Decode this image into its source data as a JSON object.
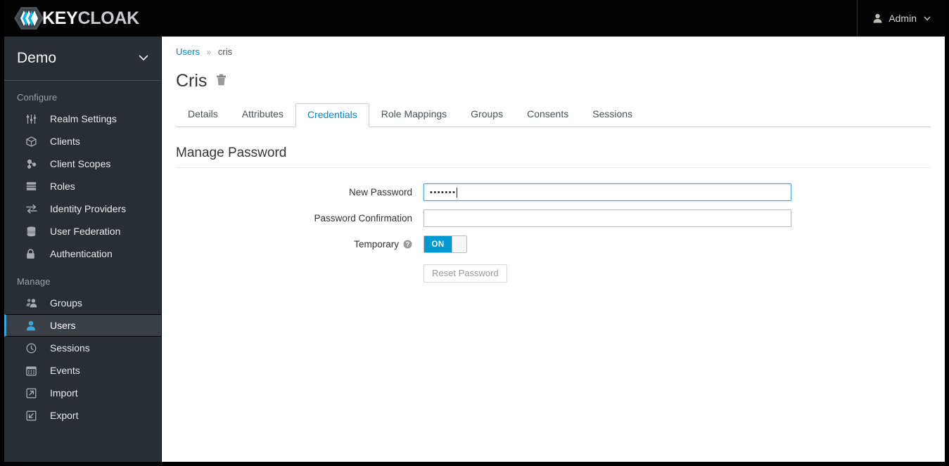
{
  "navbar": {
    "brand_part1": "KEY",
    "brand_part2": "CLOAK",
    "user_label": "Admin"
  },
  "sidebar": {
    "realm": "Demo",
    "groups": [
      {
        "label": "Configure",
        "items": [
          {
            "label": "Realm Settings",
            "icon": "sliders-icon",
            "active": false
          },
          {
            "label": "Clients",
            "icon": "cube-icon",
            "active": false
          },
          {
            "label": "Client Scopes",
            "icon": "molecule-icon",
            "active": false
          },
          {
            "label": "Roles",
            "icon": "server-stack-icon",
            "active": false
          },
          {
            "label": "Identity Providers",
            "icon": "exchange-arrows-icon",
            "active": false
          },
          {
            "label": "User Federation",
            "icon": "database-icon",
            "active": false
          },
          {
            "label": "Authentication",
            "icon": "lock-icon",
            "active": false
          }
        ]
      },
      {
        "label": "Manage",
        "items": [
          {
            "label": "Groups",
            "icon": "users-group-icon",
            "active": false
          },
          {
            "label": "Users",
            "icon": "user-icon",
            "active": true
          },
          {
            "label": "Sessions",
            "icon": "clock-icon",
            "active": false
          },
          {
            "label": "Events",
            "icon": "calendar-icon",
            "active": false
          },
          {
            "label": "Import",
            "icon": "import-arrow-icon",
            "active": false
          },
          {
            "label": "Export",
            "icon": "export-arrow-icon",
            "active": false
          }
        ]
      }
    ]
  },
  "breadcrumb": {
    "parent": "Users",
    "separator": "»",
    "current": "cris"
  },
  "page": {
    "title": "Cris"
  },
  "tabs": [
    {
      "label": "Details",
      "active": false
    },
    {
      "label": "Attributes",
      "active": false
    },
    {
      "label": "Credentials",
      "active": true
    },
    {
      "label": "Role Mappings",
      "active": false
    },
    {
      "label": "Groups",
      "active": false
    },
    {
      "label": "Consents",
      "active": false
    },
    {
      "label": "Sessions",
      "active": false
    }
  ],
  "form": {
    "section_title": "Manage Password",
    "new_password": {
      "label": "New Password",
      "value": "•••••••",
      "placeholder": ""
    },
    "password_confirmation": {
      "label": "Password Confirmation",
      "value": "",
      "placeholder": ""
    },
    "temporary": {
      "label": "Temporary",
      "state": "ON"
    },
    "reset_button": "Reset Password"
  },
  "colors": {
    "accent_blue": "#0088ce",
    "toggle_blue": "#0099d3",
    "sidebar_bg": "#292e34",
    "navbar_bg": "#030303",
    "active_item_bg": "#393f44",
    "active_indicator": "#39a5dc"
  }
}
